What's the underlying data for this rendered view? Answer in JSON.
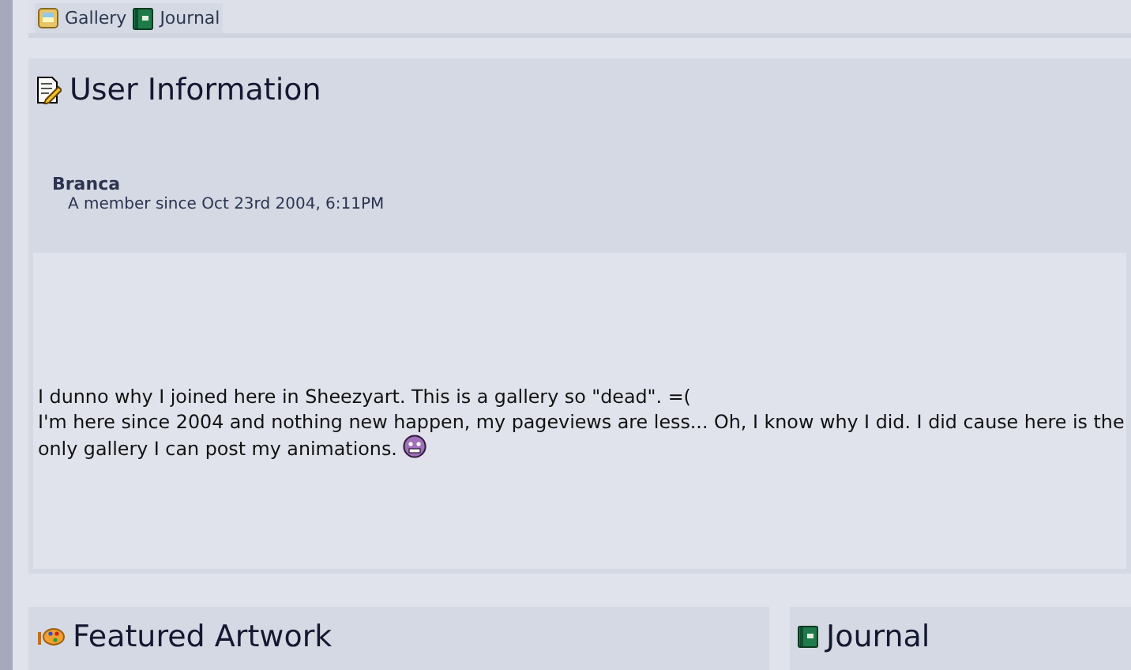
{
  "tabs": [
    {
      "label": "Gallery",
      "kind": "gallery"
    },
    {
      "label": "Journal",
      "kind": "journal"
    }
  ],
  "user_information": {
    "title": "User Information",
    "username": "Branca",
    "member_since": "A member since Oct 23rd 2004, 6:11PM",
    "bio": [
      "I dunno why I joined here in Sheezyart. This is a gallery so \"dead\". =(",
      "I'm here since 2004 and nothing new happen, my pageviews are less... Oh, I know why I did. I did cause here is the only gallery I can post my animations."
    ]
  },
  "panels": [
    {
      "title": "Featured Artwork",
      "kind": "palette"
    },
    {
      "title": "Journal",
      "kind": "journal"
    }
  ]
}
